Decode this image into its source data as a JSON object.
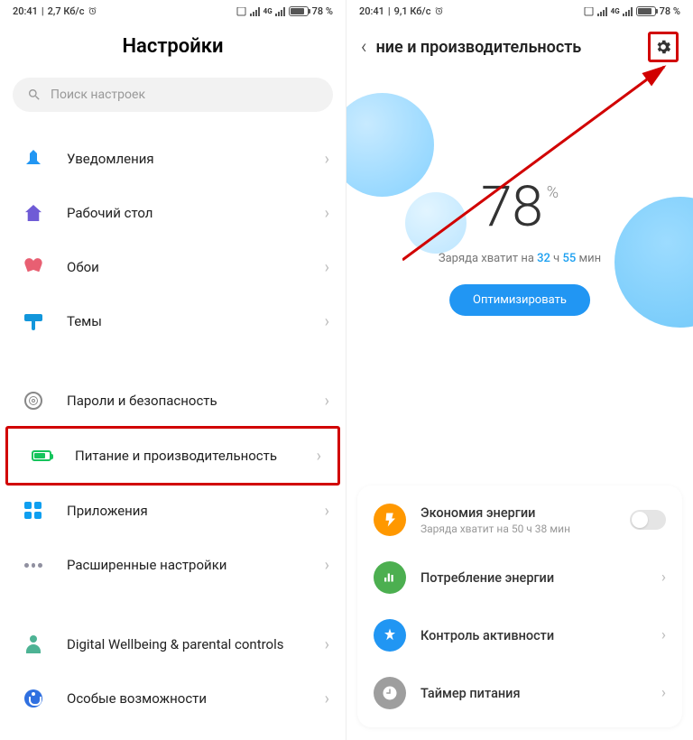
{
  "left": {
    "status": {
      "time": "20:41",
      "speed": "2,7 Кб/с",
      "battery_pct": "78 %"
    },
    "title": "Настройки",
    "search": {
      "placeholder": "Поиск настроек"
    },
    "groups": [
      [
        {
          "key": "notifications",
          "label": "Уведомления"
        },
        {
          "key": "desktop",
          "label": "Рабочий стол"
        },
        {
          "key": "wallpaper",
          "label": "Обои"
        },
        {
          "key": "themes",
          "label": "Темы"
        }
      ],
      [
        {
          "key": "security",
          "label": "Пароли и безопасность"
        },
        {
          "key": "power",
          "label": "Питание и производительность",
          "highlighted": true
        },
        {
          "key": "apps",
          "label": "Приложения"
        },
        {
          "key": "advanced",
          "label": "Расширенные настройки"
        }
      ],
      [
        {
          "key": "wellbeing",
          "label": "Digital Wellbeing & parental controls"
        },
        {
          "key": "accessibility",
          "label": "Особые возможности"
        }
      ]
    ]
  },
  "right": {
    "status": {
      "time": "20:41",
      "speed": "9,1 Кб/с",
      "battery_pct": "78 %"
    },
    "header": {
      "title": "ние и производительность"
    },
    "battery": {
      "pct": "78",
      "pct_symbol": "%",
      "estimate_prefix": "Заряда хватит на ",
      "hours": "32",
      "h_label": " ч ",
      "mins": "55",
      "m_label": " мин",
      "optimize": "Оптимизировать"
    },
    "cards": [
      {
        "key": "saver",
        "title": "Экономия энергии",
        "sub": "Заряда хватит на 50 ч 38 мин",
        "toggle": true
      },
      {
        "key": "usage",
        "title": "Потребление энергии"
      },
      {
        "key": "activity",
        "title": "Контроль активности"
      },
      {
        "key": "timer",
        "title": "Таймер питания"
      }
    ]
  }
}
